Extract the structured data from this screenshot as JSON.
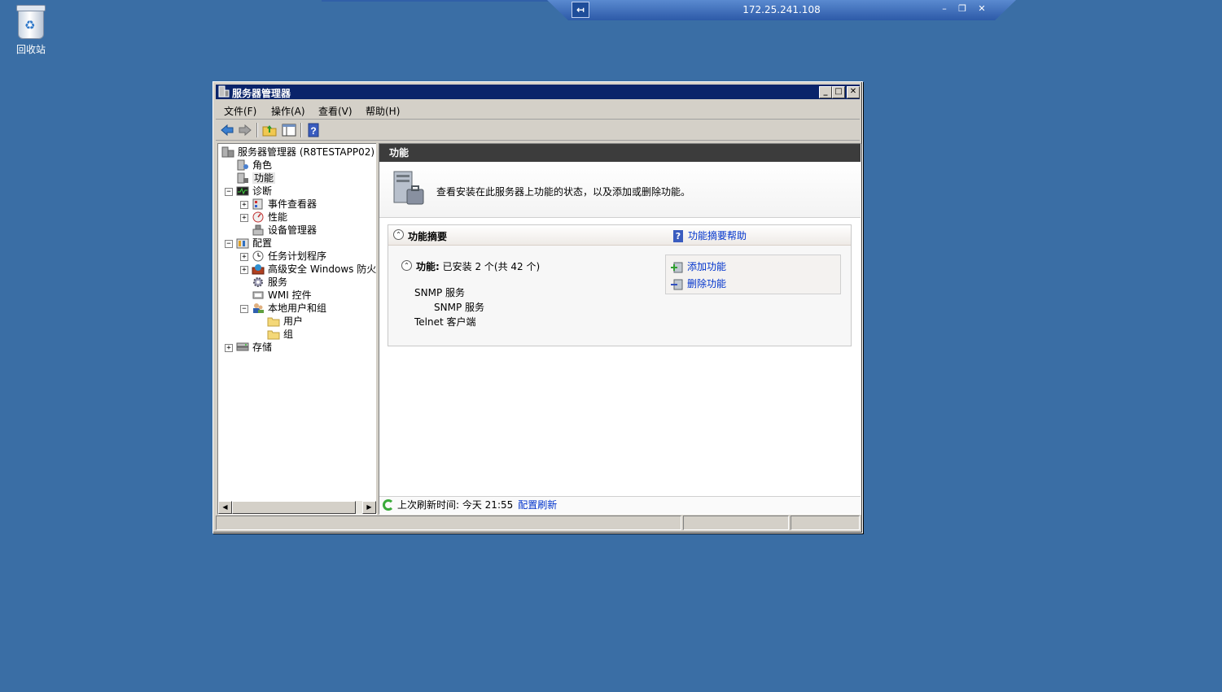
{
  "rdp": {
    "host": "172.25.241.108",
    "pin_label": "↤",
    "min_label": "–",
    "restore_label": "❐",
    "close_label": "✕"
  },
  "desktop": {
    "recycle_bin_label": "回收站"
  },
  "window": {
    "title": "服务器管理器",
    "min_label": "_",
    "max_label": "□",
    "close_label": "✕"
  },
  "menu": [
    "文件(F)",
    "操作(A)",
    "查看(V)",
    "帮助(H)"
  ],
  "toolbar": {
    "back_icon": "back-arrow-icon",
    "forward_icon": "forward-arrow-icon",
    "up_icon": "folder-up-icon",
    "show_hide_icon": "console-tree-icon",
    "help_icon": "help-icon"
  },
  "tree": {
    "root": "服务器管理器 (R8TESTAPP02)",
    "roles": "角色",
    "features": "功能",
    "diagnostics": "诊断",
    "event_viewer": "事件查看器",
    "performance": "性能",
    "device_manager": "设备管理器",
    "configuration": "配置",
    "task_scheduler": "任务计划程序",
    "firewall": "高级安全 Windows 防火墙",
    "services": "服务",
    "wmi": "WMI 控件",
    "local_users": "本地用户和组",
    "users": "用户",
    "groups": "组",
    "storage": "存储",
    "expander_plus": "+",
    "expander_minus": "−"
  },
  "right": {
    "header": "功能",
    "intro": "查看安装在此服务器上功能的状态，以及添加或删除功能。",
    "summary_title": "功能摘要",
    "summary_help": "功能摘要帮助",
    "help_glyph": "?",
    "collapse_glyph": "⌃",
    "features_label": "功能:",
    "features_count": " 已安装 2 个(共 42 个)",
    "features": [
      "SNMP 服务",
      "SNMP 服务",
      "Telnet 客户端"
    ],
    "add_features": "添加功能",
    "remove_features": "删除功能",
    "last_refresh": "上次刷新时间: 今天 21:55",
    "configure_refresh": "配置刷新"
  },
  "scroll": {
    "left_glyph": "◀",
    "right_glyph": "▶"
  }
}
